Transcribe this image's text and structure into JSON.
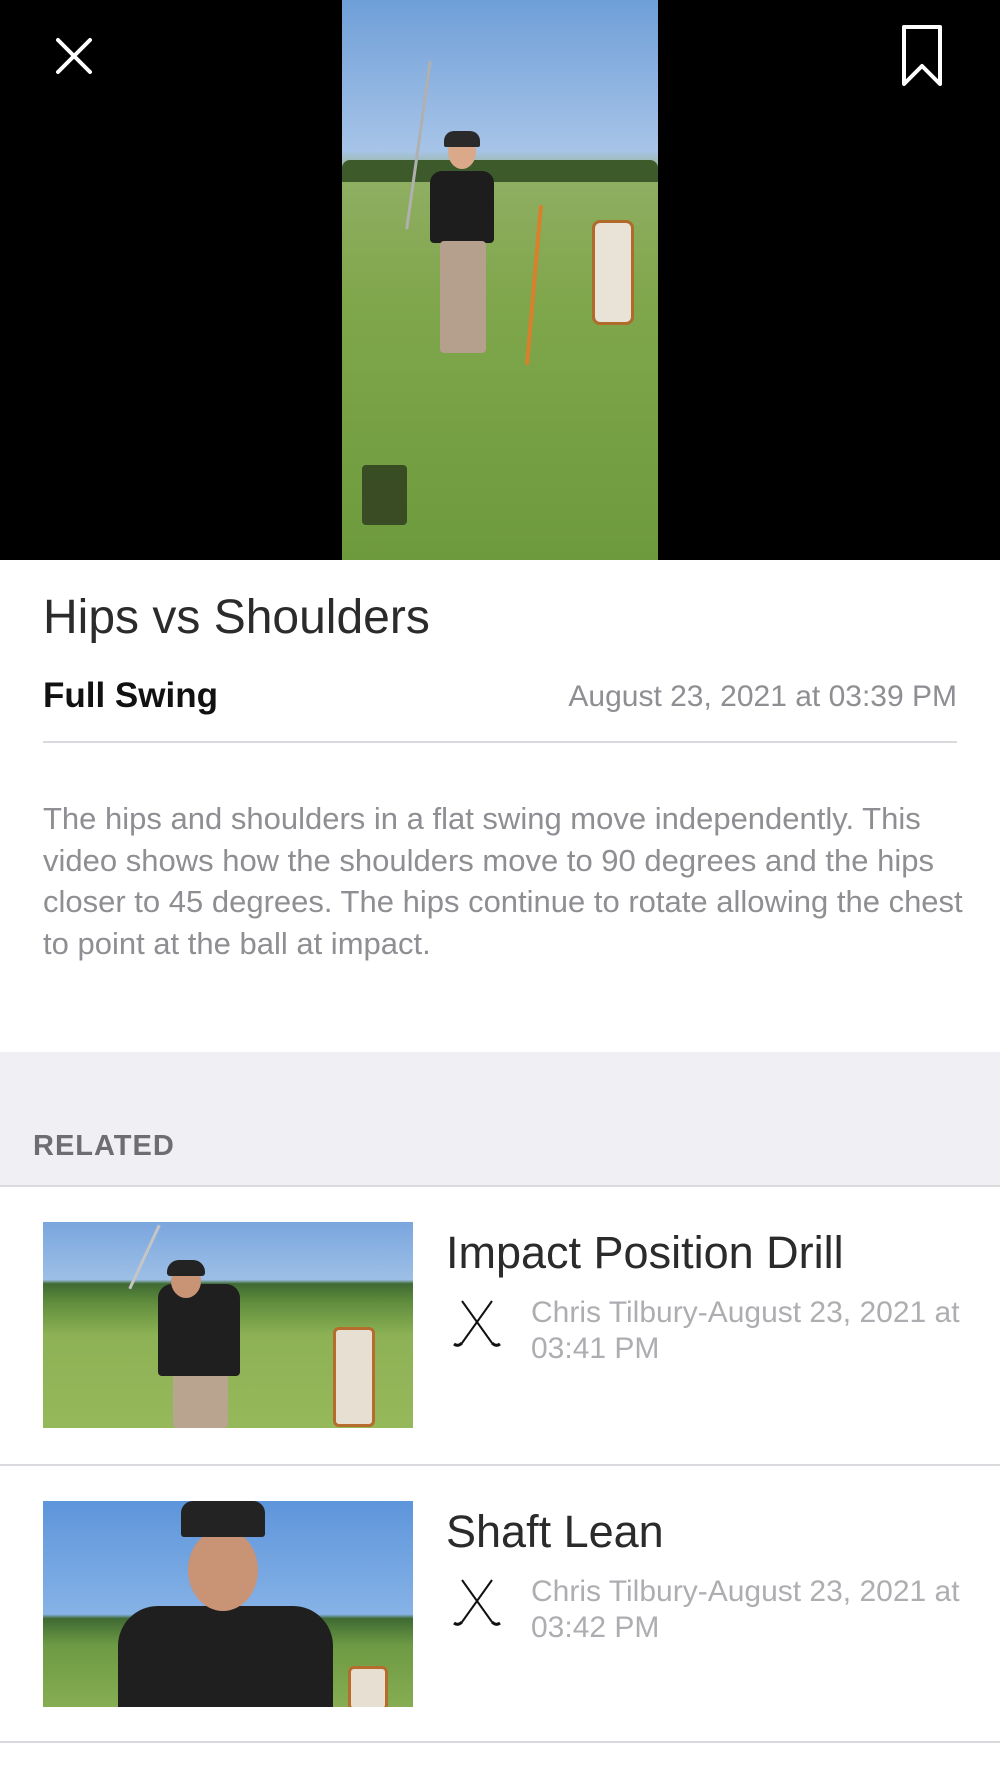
{
  "video": {
    "close_icon": "close-icon",
    "bookmark_icon": "bookmark-icon"
  },
  "detail": {
    "title": "Hips vs Shoulders",
    "category": "Full Swing",
    "date": "August 23, 2021 at 03:39 PM",
    "description": "The hips and shoulders in a flat swing move independently.  This video shows how the shoulders move to 90 degrees and the hips closer to 45 degrees.  The hips continue to rotate allowing the chest to point at the ball at impact."
  },
  "related": {
    "header": "RELATED",
    "items": [
      {
        "title": "Impact Position Drill",
        "meta": "Chris Tilbury-August 23, 2021 at 03:41 PM",
        "icon": "crossed-clubs-icon"
      },
      {
        "title": "Shaft Lean",
        "meta": "Chris Tilbury-August 23, 2021 at 03:42 PM",
        "icon": "crossed-clubs-icon"
      }
    ]
  },
  "colors": {
    "video_background": "#000000",
    "section_background": "#efeff4",
    "secondary_text": "#8e8e93",
    "divider": "#d9d9de"
  }
}
